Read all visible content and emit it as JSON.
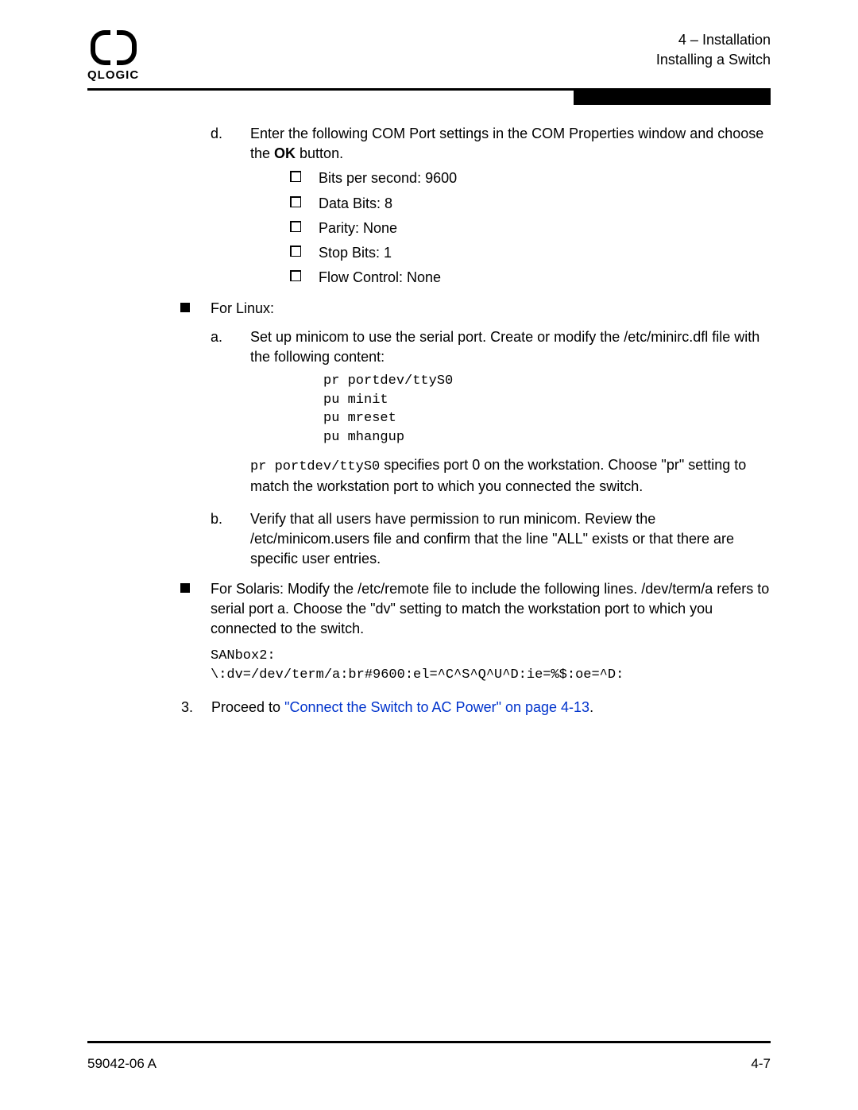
{
  "header": {
    "brand": "QLOGIC",
    "chapter": "4 – Installation",
    "section": "Installing a Switch"
  },
  "stepD": {
    "label": "d.",
    "text_pre": "Enter the following COM Port settings in the COM Properties window and choose the ",
    "ok": "OK",
    "text_post": " button.",
    "items": {
      "bps": "Bits per second: 9600",
      "databits": "Data Bits: 8",
      "parity": "Parity: None",
      "stopbits": "Stop Bits: 1",
      "flow": "Flow Control: None"
    }
  },
  "linux": {
    "title": "For Linux:",
    "a": {
      "label": "a.",
      "text": "Set up minicom to use the serial port. Create or modify the /etc/minirc.dfl file with the following content:",
      "code": "pr portdev/ttyS0\npu minit\npu mreset\npu mhangup",
      "after_code_mono": "pr portdev/ttyS0",
      "after_code_text": " specifies port 0 on the workstation. Choose \"pr\" setting to match the workstation port to which you connected the switch."
    },
    "b": {
      "label": "b.",
      "text": "Verify that all users have permission to run minicom. Review the /etc/minicom.users file and confirm that the line \"ALL\" exists or that there are specific user entries."
    }
  },
  "solaris": {
    "text": "For Solaris: Modify the /etc/remote file to include the following lines. /dev/term/a refers to serial port a. Choose the \"dv\" setting to match the workstation port to which you connected to the switch.",
    "code": "SANbox2:\n\\:dv=/dev/term/a:br#9600:el=^C^S^Q^U^D:ie=%$:oe=^D:"
  },
  "step3": {
    "label": "3.",
    "pre": "Proceed to ",
    "link": "\"Connect the Switch to AC Power\" on page 4-13",
    "post": "."
  },
  "footer": {
    "doc": "59042-06  A",
    "page": "4-7"
  }
}
